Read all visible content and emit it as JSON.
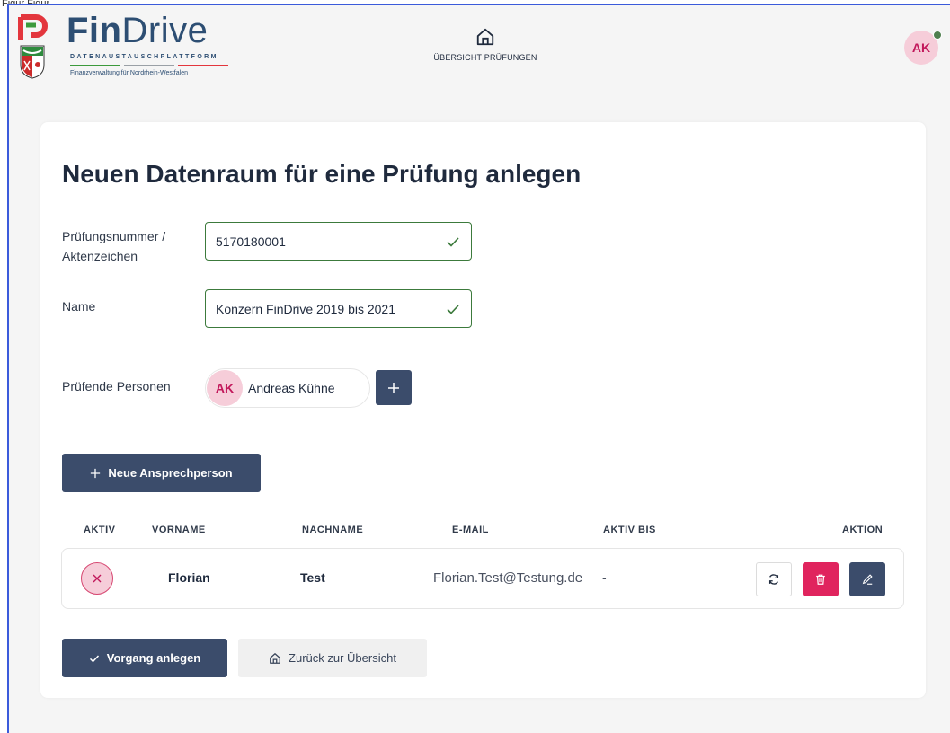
{
  "window_caption": "Figur Figur",
  "header": {
    "brand_bold": "Fin",
    "brand_light": "Drive",
    "brand_subtitle": "DATENAUSTAUSCHPLATTFORM",
    "brand_tagline": "Finanzverwaltung für Nordrhein-Westfalen",
    "nav_home_label": "ÜBERSICHT PRÜFUNGEN",
    "user_initials": "AK",
    "accent_colors": {
      "green": "#3c9a3c",
      "grey": "#9aa0a6",
      "red": "#e3363d"
    }
  },
  "form": {
    "title": "Neuen Datenraum für eine Prüfung anlegen",
    "exam_number_label_line1": "Prüfungsnummer /",
    "exam_number_label_line2": "Aktenzeichen",
    "exam_number_value": "5170180001",
    "name_label": "Name",
    "name_value": "Konzern FinDrive 2019 bis 2021",
    "examiners_label": "Prüfende Personen",
    "examiner": {
      "initials": "AK",
      "name": "Andreas Kühne"
    },
    "add_examiner_icon": "plus-icon"
  },
  "contacts": {
    "new_contact_label": "Neue Ansprechperson",
    "columns": [
      "AKTIV",
      "VORNAME",
      "NACHNAME",
      "E-MAIL",
      "AKTIV BIS",
      "AKTION"
    ],
    "rows": [
      {
        "active": false,
        "first_name": "Florian",
        "last_name": "Test",
        "email": "Florian.Test@Testung.de",
        "active_until": "-"
      }
    ]
  },
  "actions": {
    "create_label": "Vorgang anlegen",
    "back_label": "Zurück zur Übersicht"
  },
  "colors": {
    "primary_dark": "#3b4c6b",
    "danger": "#e0245e",
    "valid_border": "#3c7a3c",
    "avatar_bg": "#f6cdd9",
    "avatar_text": "#c2185b"
  }
}
